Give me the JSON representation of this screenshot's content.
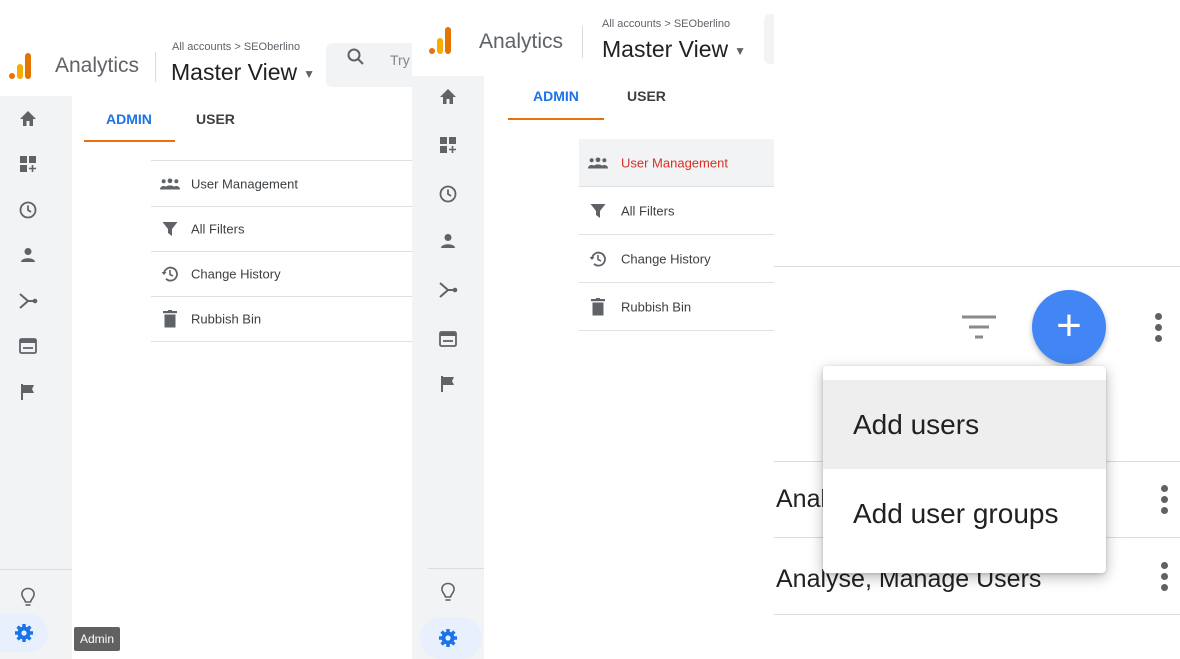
{
  "screenshot_a": {
    "app_name": "Analytics",
    "breadcrumb": "All accounts > SEOberlino",
    "view_name": "Master View",
    "search_placeholder": "Try",
    "tabs": [
      "ADMIN",
      "USER"
    ],
    "menu": [
      {
        "label": "User Management",
        "icon": "people-icon"
      },
      {
        "label": "All Filters",
        "icon": "filter-icon"
      },
      {
        "label": "Change History",
        "icon": "history-icon"
      },
      {
        "label": "Rubbish Bin",
        "icon": "trash-icon"
      }
    ],
    "tooltip": "Admin"
  },
  "screenshot_b": {
    "app_name": "Analytics",
    "breadcrumb": "All accounts > SEOberlino",
    "view_name": "Master View",
    "tabs": [
      "ADMIN",
      "USER"
    ],
    "menu": [
      {
        "label": "User Management",
        "icon": "people-icon",
        "selected": true
      },
      {
        "label": "All Filters",
        "icon": "filter-icon"
      },
      {
        "label": "Change History",
        "icon": "history-icon"
      },
      {
        "label": "Rubbish Bin",
        "icon": "trash-icon"
      }
    ]
  },
  "screenshot_c": {
    "add_button": "+",
    "dropdown": [
      "Add users",
      "Add user groups"
    ],
    "rows": [
      "Anal",
      "Analyse, Manage Users"
    ]
  },
  "colors": {
    "accent_blue": "#1a73e8",
    "tab_underline": "#e8710a",
    "selected_item_red": "#d93025",
    "fab_blue": "#4285f4"
  }
}
